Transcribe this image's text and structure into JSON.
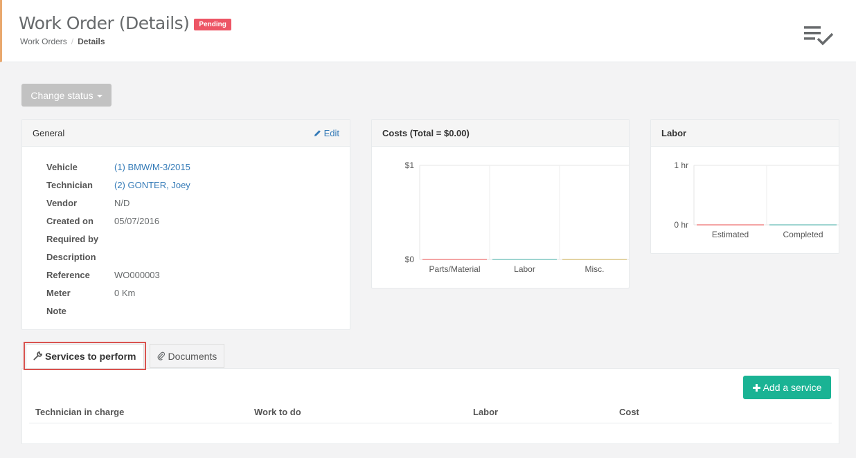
{
  "header": {
    "title": "Work Order (Details)",
    "status_badge": "Pending",
    "breadcrumb": [
      "Work Orders",
      "Details"
    ],
    "icon": "checklist-icon"
  },
  "actions": {
    "change_status_label": "Change status"
  },
  "general": {
    "heading": "General",
    "edit_label": "Edit",
    "fields": [
      {
        "label": "Vehicle",
        "value": "(1) BMW/M-3/2015"
      },
      {
        "label": "Technician",
        "value": "(2) GONTER, Joey"
      },
      {
        "label": "Vendor",
        "value": "N/D"
      },
      {
        "label": "Created on",
        "value": "05/07/2016"
      },
      {
        "label": "Required by",
        "value": ""
      },
      {
        "label": "Description",
        "value": ""
      },
      {
        "label": "Reference",
        "value": "WO000003"
      },
      {
        "label": "Meter",
        "value": "0 Km"
      },
      {
        "label": "Note",
        "value": ""
      }
    ]
  },
  "costs": {
    "heading": "Costs (Total = $0.00)"
  },
  "labor": {
    "heading": "Labor"
  },
  "chart_data": [
    {
      "type": "bar",
      "title": "Costs (Total = $0.00)",
      "categories": [
        "Parts/Material",
        "Labor",
        "Misc."
      ],
      "values": [
        0,
        0,
        0
      ],
      "yticks": [
        "$0",
        "$1"
      ],
      "ylim": [
        0,
        1
      ],
      "colors": [
        "#f4a5a5",
        "#9fd5d1",
        "#e3d3a3"
      ]
    },
    {
      "type": "bar",
      "title": "Labor",
      "categories": [
        "Estimated",
        "Completed"
      ],
      "values": [
        0,
        0
      ],
      "yticks": [
        "0 hr",
        "1 hr"
      ],
      "ylim": [
        0,
        1
      ],
      "colors": [
        "#f4a5a5",
        "#9fd5d1"
      ]
    }
  ],
  "tabs": [
    {
      "label": "Services to perform",
      "icon": "wrench-icon"
    },
    {
      "label": "Documents",
      "icon": "paperclip-icon"
    }
  ],
  "services": {
    "add_label": "Add a service",
    "columns": [
      "Technician in charge",
      "Work to do",
      "Labor",
      "Cost"
    ]
  }
}
